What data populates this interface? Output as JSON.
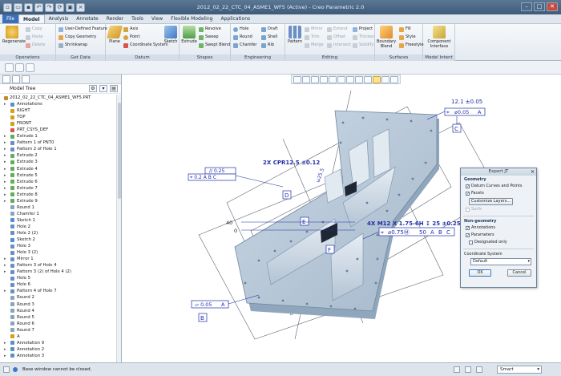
{
  "window": {
    "title": "2012_02_22_CTC_04_ASME1_WF5 (Active) - Creo Parametric 2.0",
    "controls": [
      "–",
      "□",
      "✕"
    ]
  },
  "menu": {
    "file": "File",
    "tabs": [
      "Model",
      "Analysis",
      "Annotate",
      "Render",
      "Tools",
      "View",
      "Flexible Modeling",
      "Applications"
    ]
  },
  "ribbon": {
    "operations": {
      "label": "Operations",
      "regenerate": "Regenerate",
      "copy": "Copy",
      "paste": "Paste",
      "delete": "Delete"
    },
    "get_data": {
      "label": "Get Data",
      "udf": "User-Defined Feature",
      "copy_geometry": "Copy Geometry",
      "shrinkwrap": "Shrinkwrap"
    },
    "datum": {
      "label": "Datum",
      "plane": "Plane",
      "axis": "Axis",
      "point": "Point",
      "csys": "Coordinate System",
      "sketch": "Sketch"
    },
    "shapes": {
      "label": "Shapes",
      "extrude": "Extrude",
      "revolve": "Revolve",
      "sweep": "Sweep",
      "swept_blend": "Swept Blend"
    },
    "engineering": {
      "label": "Engineering",
      "hole": "Hole",
      "round": "Round",
      "chamfer": "Chamfer",
      "draft": "Draft",
      "shell": "Shell",
      "rib": "Rib"
    },
    "editing": {
      "label": "Editing",
      "pattern": "Pattern",
      "mirror": "Mirror",
      "merge": "Merge",
      "trim": "Trim",
      "extend": "Extend",
      "offset": "Offset",
      "intersect": "Intersect",
      "project": "Project",
      "thicken": "Thicken",
      "solidify": "Solidify"
    },
    "surfaces": {
      "label": "Surfaces",
      "fill": "Fill",
      "style": "Style",
      "freestyle": "Freestyle",
      "boundary_blend": "Boundary Blend"
    },
    "model_intent": {
      "label": "Model Intent",
      "component_interface": "Component Interface"
    }
  },
  "model_tree": {
    "header": "Model Tree",
    "items": [
      {
        "label": "2012_02_22_CTC_04_ASME1_WF5.PRT",
        "level": 0,
        "expand": "",
        "icon": "part",
        "color": "#c58a2c"
      },
      {
        "label": "Annotations",
        "level": 1,
        "expand": "▸",
        "icon": "annotation",
        "color": "#5b8fc9"
      },
      {
        "label": "RIGHT",
        "level": 1,
        "expand": "",
        "icon": "datum-plane",
        "color": "#d4a017"
      },
      {
        "label": "TOP",
        "level": 1,
        "expand": "",
        "icon": "datum-plane",
        "color": "#d4a017"
      },
      {
        "label": "FRONT",
        "level": 1,
        "expand": "",
        "icon": "datum-plane",
        "color": "#d4a017"
      },
      {
        "label": "PRT_CSYS_DEF",
        "level": 1,
        "expand": "",
        "icon": "csys",
        "color": "#d9534f"
      },
      {
        "label": "Extrude 1",
        "level": 1,
        "expand": "▸",
        "icon": "extrude",
        "color": "#5fae5a"
      },
      {
        "label": "Pattern 1 of PNT0",
        "level": 1,
        "expand": "▸",
        "icon": "pattern",
        "color": "#6a8fc2"
      },
      {
        "label": "Pattern 2 of Hole 1",
        "level": 1,
        "expand": "▸",
        "icon": "pattern",
        "color": "#6a8fc2"
      },
      {
        "label": "Extrude 2",
        "level": 1,
        "expand": "▸",
        "icon": "extrude",
        "color": "#5fae5a"
      },
      {
        "label": "Extrude 3",
        "level": 1,
        "expand": "▸",
        "icon": "extrude",
        "color": "#5fae5a"
      },
      {
        "label": "Extrude 4",
        "level": 1,
        "expand": "▸",
        "icon": "extrude",
        "color": "#5fae5a"
      },
      {
        "label": "Extrude 5",
        "level": 1,
        "expand": "▸",
        "icon": "extrude",
        "color": "#5fae5a"
      },
      {
        "label": "Extrude 6",
        "level": 1,
        "expand": "▸",
        "icon": "extrude",
        "color": "#5fae5a"
      },
      {
        "label": "Extrude 7",
        "level": 1,
        "expand": "▸",
        "icon": "extrude",
        "color": "#5fae5a"
      },
      {
        "label": "Extrude 8",
        "level": 1,
        "expand": "▸",
        "icon": "extrude",
        "color": "#5fae5a"
      },
      {
        "label": "Extrude 9",
        "level": 1,
        "expand": "▸",
        "icon": "extrude",
        "color": "#5fae5a"
      },
      {
        "label": "Round 1",
        "level": 1,
        "expand": "",
        "icon": "round",
        "color": "#8aa3c0"
      },
      {
        "label": "Chamfer 1",
        "level": 1,
        "expand": "",
        "icon": "chamfer",
        "color": "#8aa3c0"
      },
      {
        "label": "Sketch 1",
        "level": 1,
        "expand": "",
        "icon": "sketch",
        "color": "#4f8fd6"
      },
      {
        "label": "Hole 2",
        "level": 1,
        "expand": "",
        "icon": "hole",
        "color": "#6a8fc2"
      },
      {
        "label": "Hole 2 (2)",
        "level": 1,
        "expand": "",
        "icon": "hole",
        "color": "#6a8fc2"
      },
      {
        "label": "Sketch 2",
        "level": 1,
        "expand": "",
        "icon": "sketch",
        "color": "#4f8fd6"
      },
      {
        "label": "Hole 3",
        "level": 1,
        "expand": "",
        "icon": "hole",
        "color": "#6a8fc2"
      },
      {
        "label": "Hole 3 (2)",
        "level": 1,
        "expand": "",
        "icon": "hole",
        "color": "#6a8fc2"
      },
      {
        "label": "Mirror 1",
        "level": 1,
        "expand": "▸",
        "icon": "mirror",
        "color": "#6a8fc2"
      },
      {
        "label": "Pattern 3 of Hole 4",
        "level": 1,
        "expand": "▸",
        "icon": "pattern",
        "color": "#6a8fc2"
      },
      {
        "label": "Pattern 3 (2) of Hole 4 (2)",
        "level": 1,
        "expand": "▸",
        "icon": "pattern",
        "color": "#6a8fc2"
      },
      {
        "label": "Hole 5",
        "level": 1,
        "expand": "",
        "icon": "hole",
        "color": "#6a8fc2"
      },
      {
        "label": "Hole 6",
        "level": 1,
        "expand": "",
        "icon": "hole",
        "color": "#6a8fc2"
      },
      {
        "label": "Pattern 4 of Hole 7",
        "level": 1,
        "expand": "▸",
        "icon": "pattern",
        "color": "#6a8fc2"
      },
      {
        "label": "Round 2",
        "level": 1,
        "expand": "",
        "icon": "round",
        "color": "#8aa3c0"
      },
      {
        "label": "Round 3",
        "level": 1,
        "expand": "",
        "icon": "round",
        "color": "#8aa3c0"
      },
      {
        "label": "Round 4",
        "level": 1,
        "expand": "",
        "icon": "round",
        "color": "#8aa3c0"
      },
      {
        "label": "Round 5",
        "level": 1,
        "expand": "",
        "icon": "round",
        "color": "#8aa3c0"
      },
      {
        "label": "Round 6",
        "level": 1,
        "expand": "",
        "icon": "round",
        "color": "#8aa3c0"
      },
      {
        "label": "Round 7",
        "level": 1,
        "expand": "",
        "icon": "round",
        "color": "#8aa3c0"
      },
      {
        "label": "A",
        "level": 1,
        "expand": "",
        "icon": "datum-tag",
        "color": "#d4a017"
      },
      {
        "label": "Annotation 9",
        "level": 1,
        "expand": "▸",
        "icon": "annotation",
        "color": "#5b8fc9"
      },
      {
        "label": "Annotation 2",
        "level": 1,
        "expand": "▸",
        "icon": "annotation",
        "color": "#5b8fc9"
      },
      {
        "label": "Annotation 3",
        "level": 1,
        "expand": "▸",
        "icon": "annotation",
        "color": "#5b8fc9"
      }
    ]
  },
  "annotations": {
    "fcf_top_right": {
      "tol": "12.1 ±0.05",
      "symbol": "⌖",
      "value": "⌀0.05",
      "datum": "A"
    },
    "datum_c": "C",
    "cpr": "2X CPR12.5 ±0.12",
    "fcf_left": {
      "top": "// 0.25",
      "bottom": "⌖ 0.2 A B C"
    },
    "datum_d": "D",
    "datum_e": "E",
    "dim_40": "40",
    "dim_0": "0",
    "thread": "4X M12 X 1.75-6H ↧ 25 ±0.25",
    "fcf_thread": {
      "symbol": "⌖",
      "value": "⌀0.75Ⓜ",
      "tail": "50",
      "datums": [
        "A",
        "B",
        "C"
      ]
    },
    "datum_f": "F",
    "fcf_bottom_left": {
      "value": "⏥ 0.05",
      "datum": "A"
    },
    "datum_b": "B",
    "dim_vertical": "ω25.5"
  },
  "export_dialog": {
    "title": "Export JT",
    "geometry_label": "Geometry",
    "datum_curves": "Datum Curves and Points",
    "facets": "Facets",
    "customize_layers": "Customize Layers...",
    "surfs": "Surfs",
    "non_geometry_label": "Non-geometry",
    "annotations": "Annotations",
    "parameters": "Parameters",
    "designated_only": "Designated only",
    "coord_system_label": "Coordinate System",
    "coord_system_value": "Default",
    "ok": "OK",
    "cancel": "Cancel"
  },
  "status": {
    "message": "Base window cannot be closed.",
    "filter": "Smart"
  },
  "colors": {
    "part_fill": "#b6c7d8",
    "part_dark": "#8fa6bd",
    "annotation_blue": "#1f2fa8",
    "ribbon_bg": "#e9eef4",
    "title_bar": "#4a6685"
  }
}
